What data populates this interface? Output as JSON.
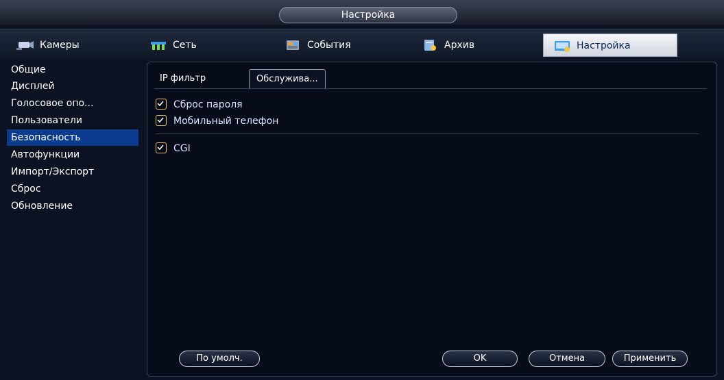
{
  "window": {
    "title": "Настройка"
  },
  "main_tabs": [
    {
      "label": "Камеры",
      "icon": "camera-icon"
    },
    {
      "label": "Сеть",
      "icon": "network-icon"
    },
    {
      "label": "События",
      "icon": "events-icon"
    },
    {
      "label": "Архив",
      "icon": "archive-icon"
    },
    {
      "label": "Настройка",
      "icon": "settings-icon",
      "active": true
    }
  ],
  "sidebar": {
    "items": [
      {
        "label": "Общие"
      },
      {
        "label": "Дисплей"
      },
      {
        "label": "Голосовое опо..."
      },
      {
        "label": "Пользователи"
      },
      {
        "label": "Безопасность",
        "active": true
      },
      {
        "label": "Автофункции"
      },
      {
        "label": "Импорт/Экспорт"
      },
      {
        "label": "Сброс"
      },
      {
        "label": "Обновление"
      }
    ]
  },
  "sub_tabs": [
    {
      "label": "IP фильтр"
    },
    {
      "label": "Обслужива...",
      "active": true
    }
  ],
  "options": [
    {
      "label": "Сброс пароля",
      "checked": true
    },
    {
      "label": "Мобильный телефон",
      "checked": true
    },
    {
      "label": "CGI",
      "checked": true
    }
  ],
  "buttons": {
    "default": "По умолч.",
    "ok": "OK",
    "cancel": "Отмена",
    "apply": "Применить"
  },
  "colors": {
    "background": "#0b1322",
    "active_item": "#0c3c8f",
    "checkbox": "#f0c060",
    "text": "#d8e4ff"
  }
}
